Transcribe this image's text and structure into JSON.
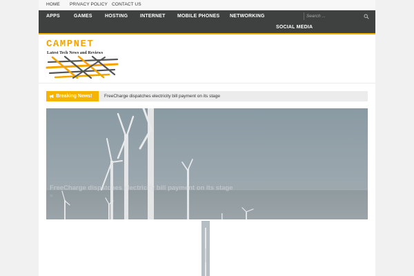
{
  "topbar": {
    "links": [
      "HOME",
      "PRIVACY POLICY",
      "CONTACT US"
    ]
  },
  "nav": {
    "items": [
      "APPS",
      "GAMES",
      "HOSTING",
      "INTERNET",
      "MOBILE PHONES",
      "NETWORKING",
      "SOCIAL MEDIA"
    ],
    "search_placeholder": "Search ..."
  },
  "logo": {
    "name": "CAMPNET",
    "tagline": "Latest Tech News and Reviews"
  },
  "breaking": {
    "label": "Breaking News!",
    "headline": "FreeCharge dispatches electricity bill payment on its stage"
  },
  "featured": {
    "title": "FreeCharge dispatches electricity bill payment on its stage"
  },
  "colors": {
    "accent": "#f5b400",
    "nav_bg": "#3f4040",
    "logo_orange": "#f5a300"
  }
}
